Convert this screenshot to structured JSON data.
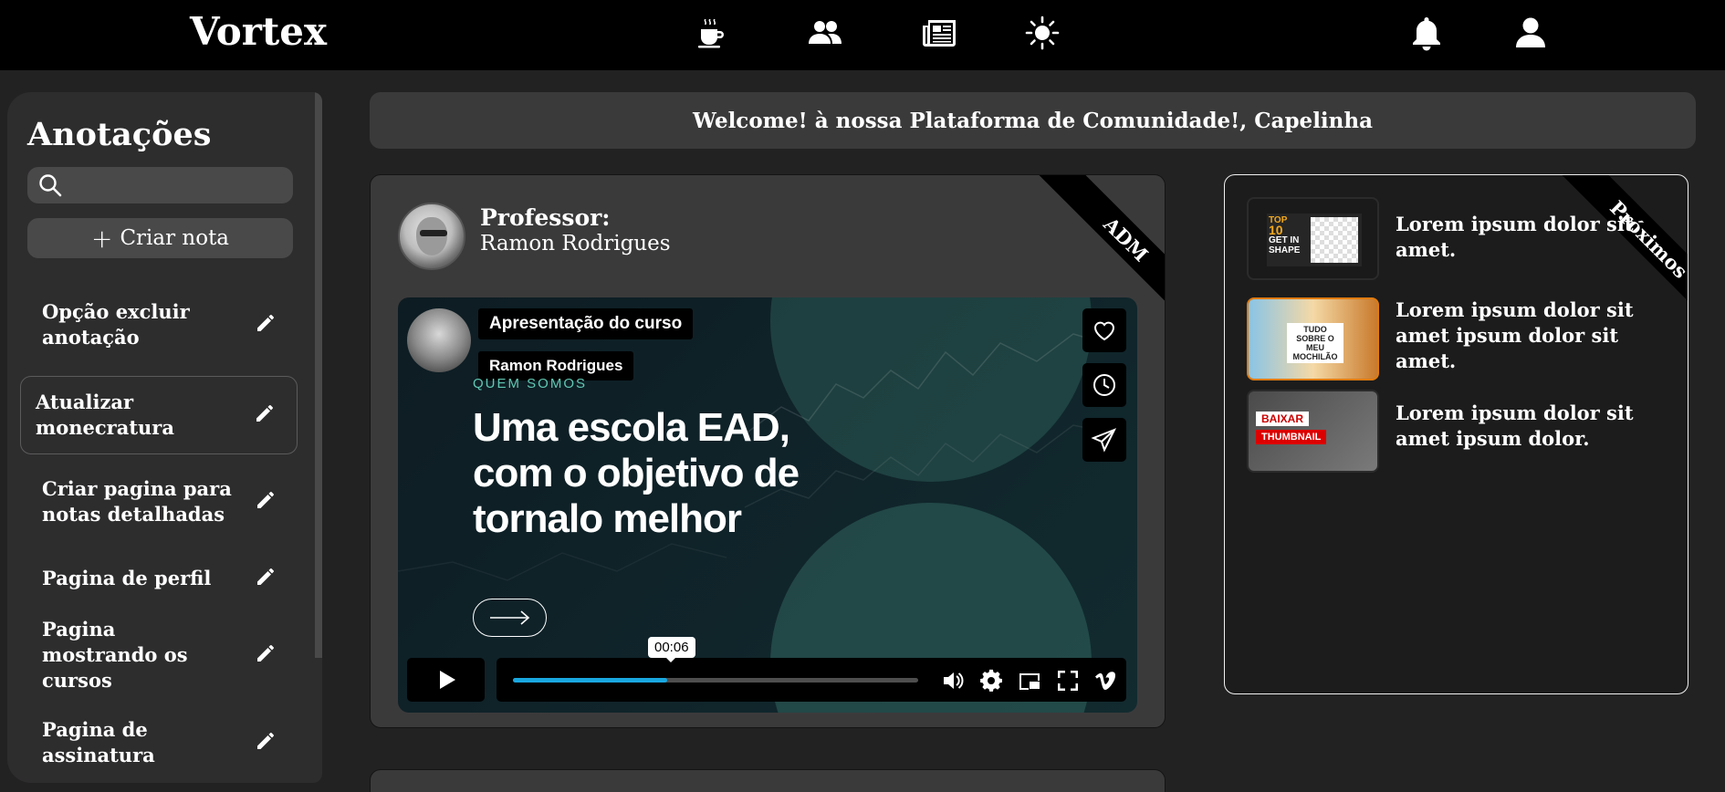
{
  "app": {
    "logo": "Vortex"
  },
  "topnav": {
    "icons": [
      "coffee-icon",
      "users-icon",
      "newspaper-icon",
      "sun-icon"
    ],
    "right_icons": [
      "bell-icon",
      "user-icon"
    ]
  },
  "sidebar": {
    "title": "Anotações",
    "search": {
      "placeholder": "",
      "value": ""
    },
    "create_label": "Criar nota",
    "notes": [
      {
        "label": "Opção excluir anotação"
      },
      {
        "label": "Atualizar monecratura"
      },
      {
        "label": "Criar pagina para notas detalhadas"
      },
      {
        "label": "Pagina de perfil"
      },
      {
        "label": "Pagina mostrando os cursos"
      },
      {
        "label": "Pagina de assinatura"
      }
    ]
  },
  "welcome": {
    "text": "Welcome! à nossa Plataforma de Comunidade!, Capelinha"
  },
  "course": {
    "professor_label": "Professor:",
    "professor_name": "Ramon Rodrigues",
    "ribbon": "ADM",
    "video": {
      "title": "Apresentação do curso",
      "author": "Ramon Rodrigues",
      "small_heading": "QUEM SOMOS",
      "headline_1": "Uma escola EAD,",
      "headline_2": "com o objetivo de",
      "headline_3": "tornalo melhor",
      "time": "00:06",
      "progress": 0.38
    }
  },
  "next": {
    "ribbon": "Próximos",
    "items": [
      {
        "text": "Lorem ipsum dolor sit amet.",
        "thumb": {
          "line1": "TOP",
          "line2": "10",
          "line3": "GET IN",
          "line4": "SHAPE"
        }
      },
      {
        "text": "Lorem ipsum dolor sit amet ipsum dolor sit amet.",
        "thumb": {
          "line1": "TUDO SOBRE O MEU MOCHILÃO"
        }
      },
      {
        "text": "Lorem ipsum dolor sit amet ipsum dolor.",
        "thumb": {
          "line1": "BAIXAR",
          "line2": "THUMBNAIL"
        }
      }
    ]
  }
}
